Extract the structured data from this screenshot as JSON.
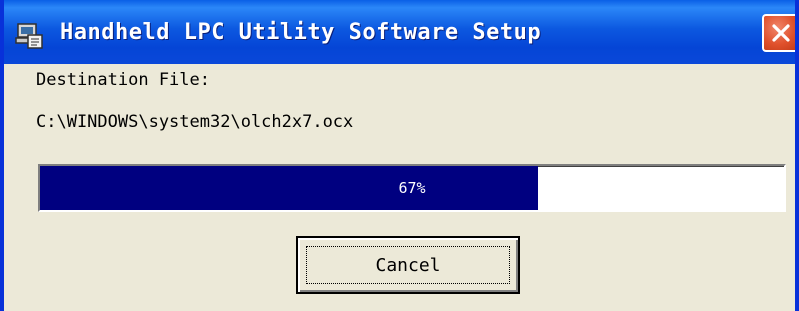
{
  "window": {
    "title": "Handheld LPC Utility Software Setup",
    "icons": {
      "app": "setup-computer-icon",
      "close": "close-icon"
    }
  },
  "content": {
    "destination_label": "Destination File:",
    "destination_path": "C:\\WINDOWS\\system32\\olch2x7.ocx"
  },
  "progress": {
    "percent": 67,
    "label": "67%",
    "fill_color": "#000080"
  },
  "buttons": {
    "cancel_label": "Cancel"
  },
  "colors": {
    "titlebar": "#0a48d9",
    "close": "#e0512c",
    "dialog_bg": "#ece9d8"
  }
}
